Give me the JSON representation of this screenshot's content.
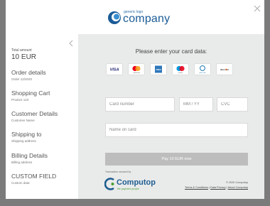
{
  "header": {
    "logo_small": "generic logo",
    "logo_big": "company"
  },
  "sidebar": {
    "total_label": "Total amount",
    "total_value": "10 EUR",
    "items": [
      {
        "title": "Order details",
        "subtitle": "Order 12/2020"
      },
      {
        "title": "Shopping Cart",
        "subtitle": "Product 123"
      },
      {
        "title": "Customer Details",
        "subtitle": "Customer Name"
      },
      {
        "title": "Shipping to",
        "subtitle": "Shipping address"
      },
      {
        "title": "Billing Details",
        "subtitle": "Billing address"
      },
      {
        "title": "CUSTOM FIELD",
        "subtitle": "Custom data"
      }
    ]
  },
  "main": {
    "prompt": "Please enter your card data:",
    "cards": [
      "VISA",
      "mastercard",
      "AMEX",
      "maestro",
      "diners club",
      "discover"
    ],
    "card_number_placeholder": "Card number",
    "expiry_placeholder": "MM / YY",
    "cvc_placeholder": "CVC",
    "name_placeholder": "Name on card",
    "pay_label": "Pay 10 EUR now"
  },
  "footer": {
    "powered_by": "Transaction secured by",
    "brand": "Computop",
    "tagline": "the payment people",
    "copyright": "© 2020 Computop",
    "links": [
      "Terms & Conditions",
      "Data Privacy",
      "About Computop"
    ],
    "link_separator": "|"
  },
  "colors": {
    "overlay": "#7b7b7b",
    "panel": "#e9eaea",
    "brand_blue": "#1b5b97",
    "pay_button": "#bdbdbd",
    "computop_green": "#4aa236"
  }
}
